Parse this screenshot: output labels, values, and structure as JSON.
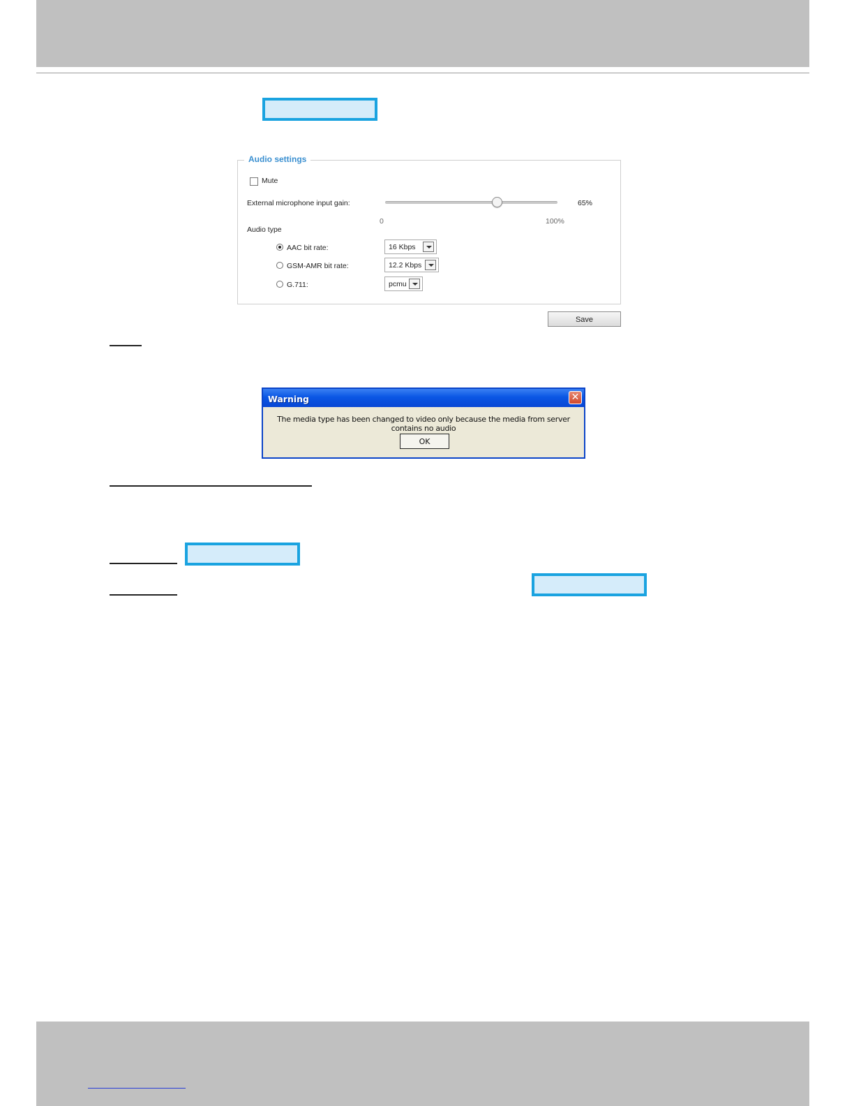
{
  "audio_settings": {
    "legend": "Audio settings",
    "mute": {
      "label": "Mute",
      "checked": false
    },
    "gain": {
      "label": "External microphone input gain:",
      "value_label": "65%",
      "value_percent": 65,
      "scale_min": "0",
      "scale_max": "100%"
    },
    "audio_type": {
      "label": "Audio type",
      "options": [
        {
          "label": "AAC bit rate:",
          "selected": true,
          "value": "16 Kbps"
        },
        {
          "label": "GSM-AMR bit rate:",
          "selected": false,
          "value": "12.2 Kbps"
        },
        {
          "label": "G.711:",
          "selected": false,
          "value": "pcmu"
        }
      ]
    },
    "save_label": "Save"
  },
  "warning_dialog": {
    "title": "Warning",
    "message": "The media type has been changed to video only because the media from server contains no audio",
    "ok_label": "OK",
    "close_glyph": "✕"
  },
  "colors": {
    "highlight_border": "#1aa3e0",
    "highlight_fill": "#d5ecfa",
    "legend_text": "#3a8fd0",
    "band_gray": "#c0c0c0"
  }
}
